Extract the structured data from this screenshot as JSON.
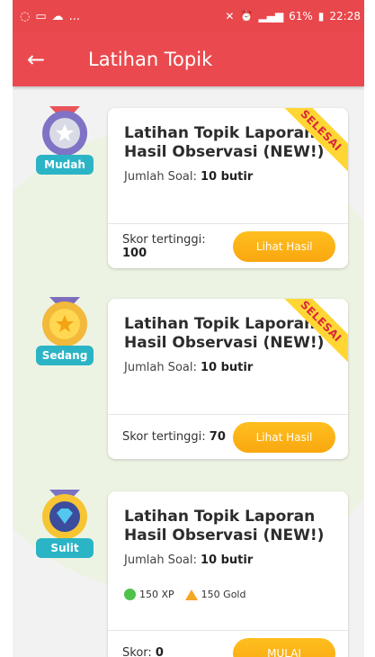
{
  "status_bar": {
    "left_icons": [
      "whatsapp-icon",
      "image-icon",
      "cloud-icon"
    ],
    "left_more": "...",
    "right_text": "61%",
    "time": "22:28"
  },
  "app_bar": {
    "title": "Latihan Topik"
  },
  "items": [
    {
      "level": "Mudah",
      "title": "Latihan Topik Laporan Hasil Observasi (NEW!)",
      "jumlah_label": "Jumlah Soal:",
      "jumlah_value": "10 butir",
      "status": "SELESAI",
      "score_label": "Skor tertinggi:",
      "score_value": "100",
      "button": "Lihat Hasil",
      "medal_color": "#7a73bf"
    },
    {
      "level": "Sedang",
      "title": "Latihan Topik Laporan Hasil Observasi (NEW!)",
      "jumlah_label": "Jumlah Soal:",
      "jumlah_value": "10 butir",
      "status": "SELESAI",
      "score_label": "Skor tertinggi:",
      "score_value": "70",
      "button": "Lihat Hasil",
      "medal_color": "#f7c12b"
    },
    {
      "level": "Sulit",
      "title": "Latihan Topik Laporan Hasil Observasi (NEW!)",
      "jumlah_label": "Jumlah Soal:",
      "jumlah_value": "10 butir",
      "reward_xp": "150 XP",
      "reward_gold": "150 Gold",
      "score_label": "Skor:",
      "score_value": "0",
      "button": "MULAI",
      "medal_color": "#47b5e8"
    }
  ]
}
